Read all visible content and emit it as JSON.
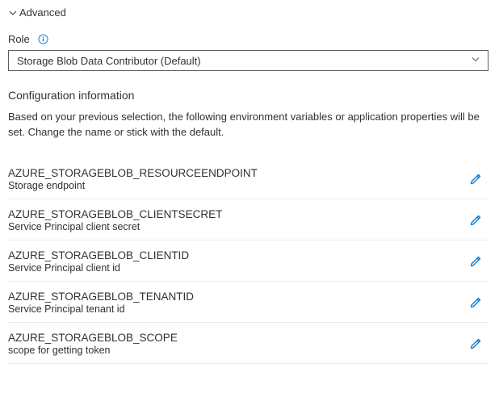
{
  "header": {
    "advanced_label": "Advanced"
  },
  "role": {
    "label": "Role",
    "selected": "Storage Blob Data Contributor (Default)"
  },
  "config": {
    "title": "Configuration information",
    "description": "Based on your previous selection, the following environment variables or application properties will be set. Change the name or stick with the default.",
    "items": [
      {
        "name": "AZURE_STORAGEBLOB_RESOURCEENDPOINT",
        "desc": "Storage endpoint"
      },
      {
        "name": "AZURE_STORAGEBLOB_CLIENTSECRET",
        "desc": "Service Principal client secret"
      },
      {
        "name": "AZURE_STORAGEBLOB_CLIENTID",
        "desc": "Service Principal client id"
      },
      {
        "name": "AZURE_STORAGEBLOB_TENANTID",
        "desc": "Service Principal tenant id"
      },
      {
        "name": "AZURE_STORAGEBLOB_SCOPE",
        "desc": "scope for getting token"
      }
    ]
  },
  "colors": {
    "accent": "#0078d4"
  }
}
